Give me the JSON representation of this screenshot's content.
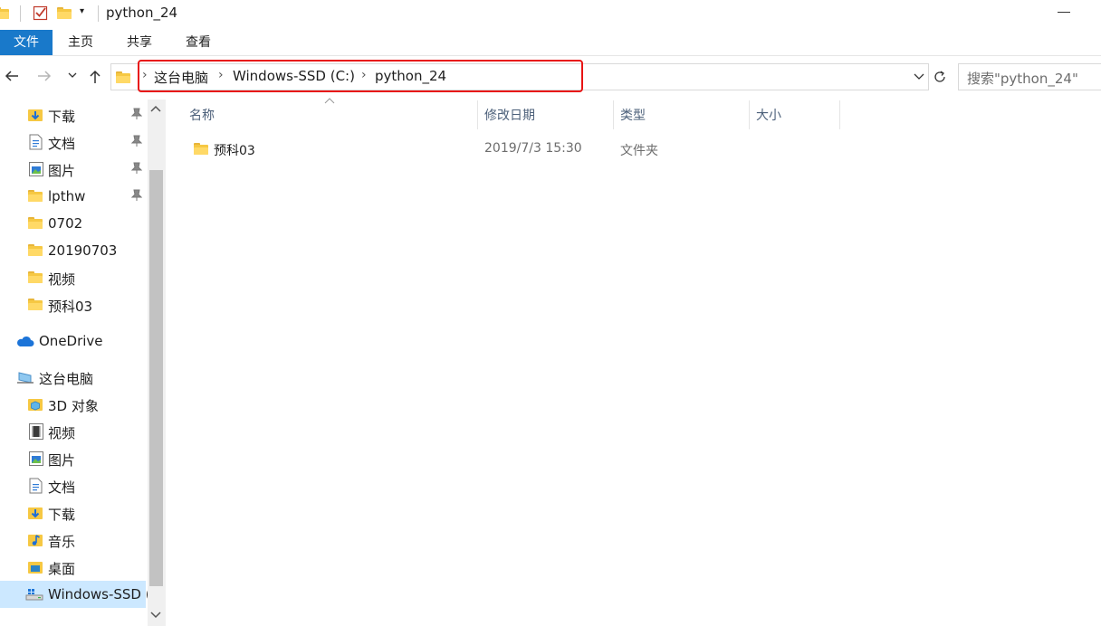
{
  "window": {
    "title": "python_24"
  },
  "ribbon": {
    "tabs": [
      "文件",
      "主页",
      "共享",
      "查看"
    ]
  },
  "address": {
    "crumbs": [
      "这台电脑",
      "Windows-SSD (C:)",
      "python_24"
    ],
    "search_placeholder": "搜索\"python_24\""
  },
  "nav": {
    "quick_access": [
      {
        "label": "下载",
        "icon": "download-icon",
        "pinned": true
      },
      {
        "label": "文档",
        "icon": "document-icon",
        "pinned": true
      },
      {
        "label": "图片",
        "icon": "picture-icon",
        "pinned": true
      },
      {
        "label": "lpthw",
        "icon": "folder-icon",
        "pinned": true
      },
      {
        "label": "0702",
        "icon": "folder-icon",
        "pinned": false
      },
      {
        "label": "20190703",
        "icon": "folder-icon",
        "pinned": false
      },
      {
        "label": "视频",
        "icon": "folder-icon",
        "pinned": false
      },
      {
        "label": "预科03",
        "icon": "folder-icon",
        "pinned": false
      }
    ],
    "onedrive": "OneDrive",
    "this_pc": "这台电脑",
    "pc_items": [
      {
        "label": "3D 对象",
        "icon": "3d-objects-icon"
      },
      {
        "label": "视频",
        "icon": "video-icon"
      },
      {
        "label": "图片",
        "icon": "picture-icon"
      },
      {
        "label": "文档",
        "icon": "document-icon"
      },
      {
        "label": "下载",
        "icon": "download-icon"
      },
      {
        "label": "音乐",
        "icon": "music-icon"
      },
      {
        "label": "桌面",
        "icon": "desktop-icon"
      },
      {
        "label": "Windows-SSD (",
        "icon": "drive-icon",
        "selected": true
      }
    ]
  },
  "columns": {
    "name": "名称",
    "modified": "修改日期",
    "type": "类型",
    "size": "大小"
  },
  "files": [
    {
      "name": "预科03",
      "modified": "2019/7/3 15:30",
      "type": "文件夹",
      "size": ""
    }
  ],
  "colors": {
    "accent": "#1979ca",
    "highlight": "#e81414",
    "folder": "#f6c843"
  }
}
